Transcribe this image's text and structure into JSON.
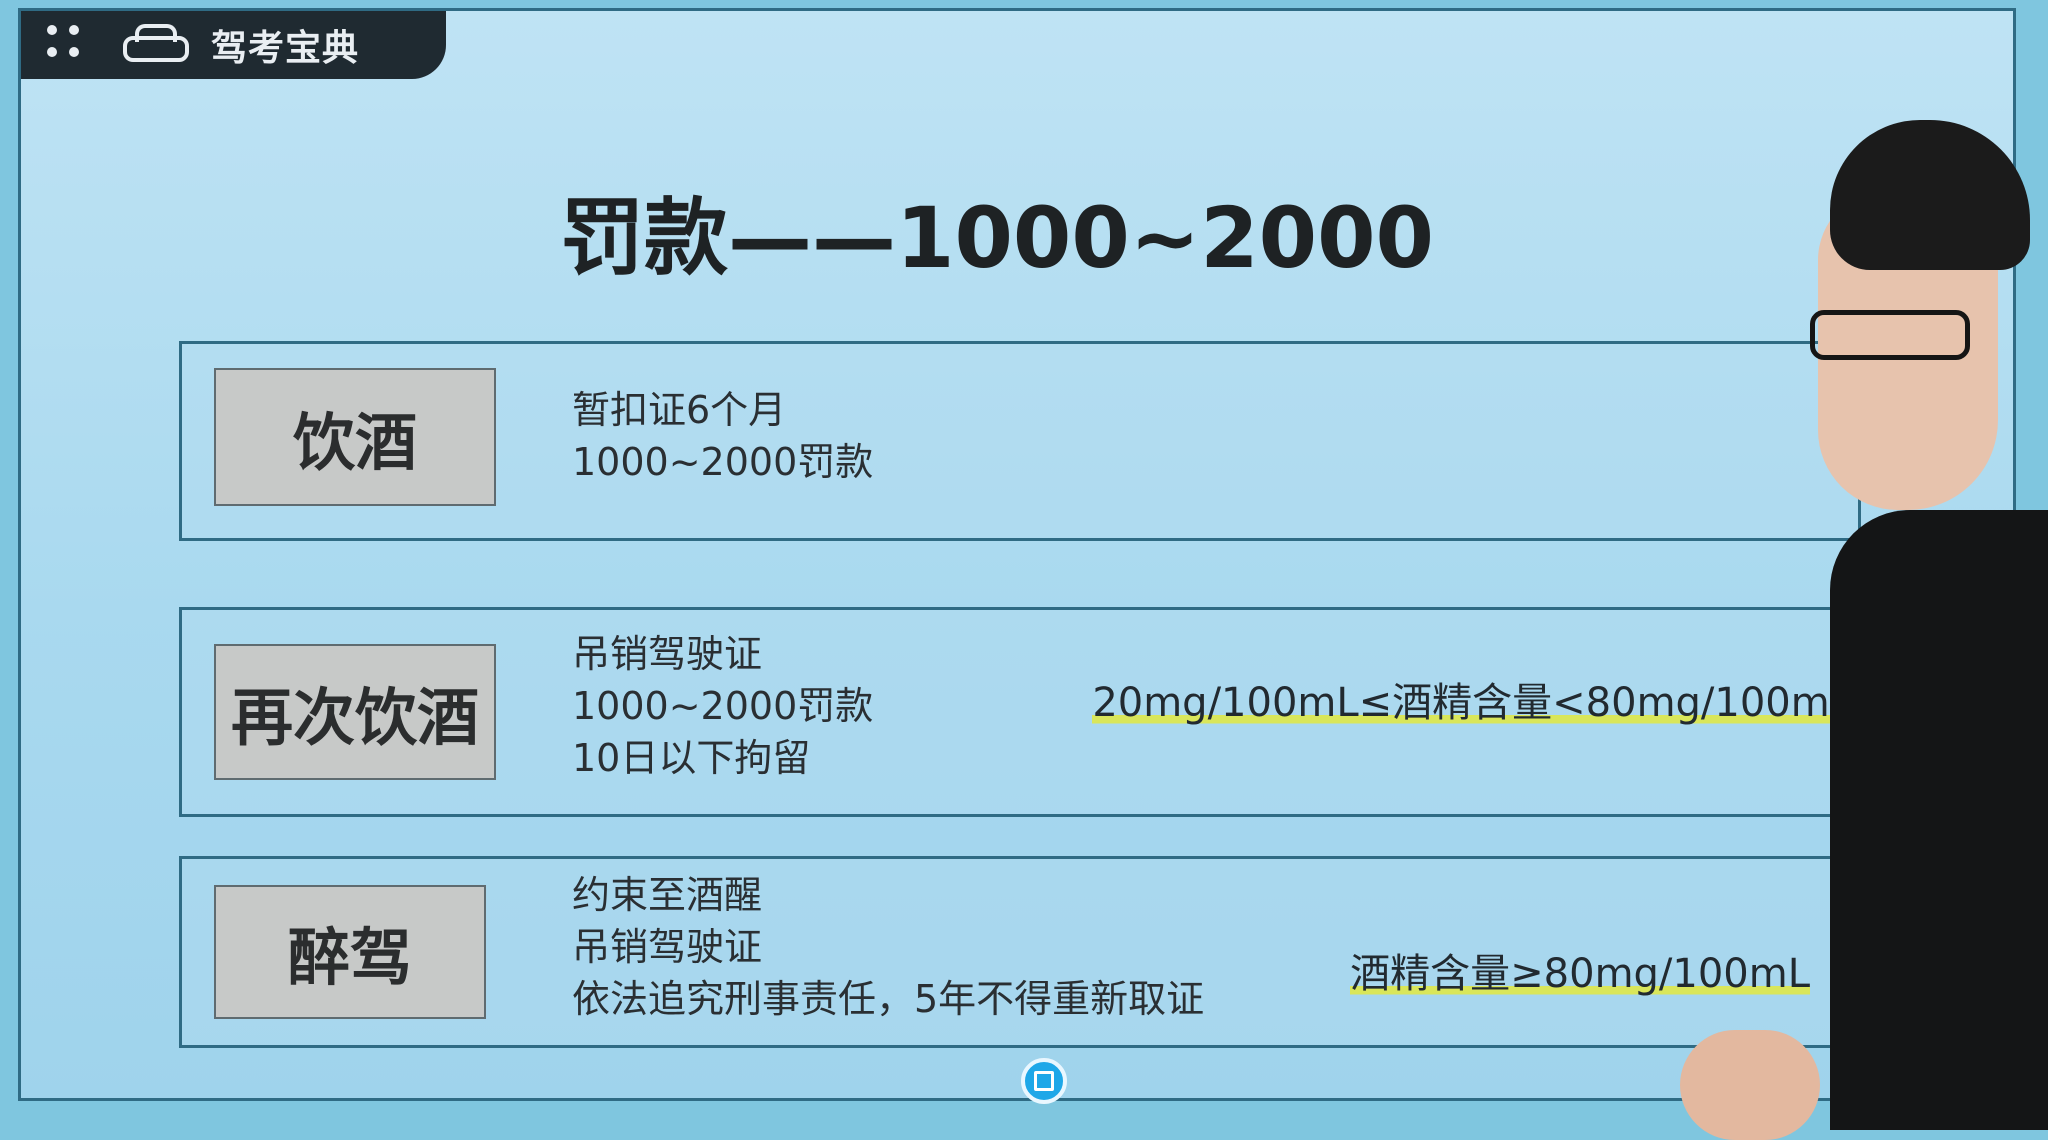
{
  "brand": {
    "name": "驾考宝典",
    "icons": [
      "grid-icon",
      "car-icon"
    ]
  },
  "slide": {
    "title": "罚款——1000~2000",
    "rows": [
      {
        "tag": "饮酒",
        "rules": [
          "暂扣证6个月",
          "1000~2000罚款"
        ],
        "condition": ""
      },
      {
        "tag": "再次饮酒",
        "rules": [
          "吊销驾驶证",
          "1000~2000罚款",
          "10日以下拘留"
        ],
        "condition": "20mg/100mL≤酒精含量<80mg/100mL"
      },
      {
        "tag": "醉驾",
        "rules": [
          "约束至酒醒",
          "吊销驾驶证",
          "依法追究刑事责任，5年不得重新取证"
        ],
        "condition": "酒精含量≥80mg/100mL"
      }
    ]
  },
  "colors": {
    "highlight": "#d9e65a",
    "panel_border": "#2f6b84",
    "tag_bg": "#c7c9c8",
    "record_button": "#1ea7e8"
  }
}
